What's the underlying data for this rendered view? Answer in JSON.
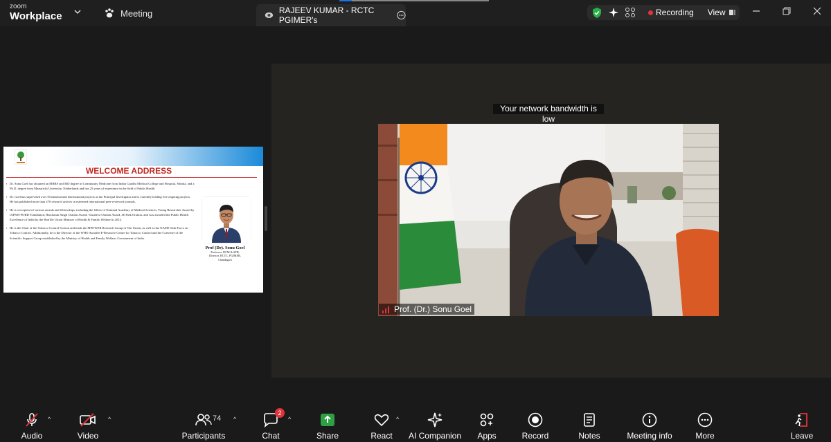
{
  "titlebar": {
    "brand_small": "zoom",
    "brand_big": "Workplace",
    "meeting_label": "Meeting",
    "share_tab_label": "RAJEEV KUMAR - RCTC PGIMER's",
    "recording_label": "Recording",
    "view_label": "View"
  },
  "slide": {
    "title": "WELCOME ADDRESS",
    "bullets": [
      "Dr. Sonu Goel has obtained an MBBS and MD degree in Community Medicine from Indira Gandhi Medical College and Hospital, Shimla, and a Ph.D. degree from Maastricht University, Netherlands and has 25 years of experience in the field of Public Health.",
      "Dr. Goel has supervised over 50 national and international projects as the Principal Investigator and is currently leading five ongoing projects. He has published more than 270 research articles in esteemed international peer-reviewed journals.",
      "He is a recipient of various awards and fellowships, including the fellow of National Academy of Medical Sciences, Young Researcher Award by IAPSM-FORD Foundation, Harcharan Singh Oration Award, Vasudeva Oration Award, JE Park Oration, and was awarded the Public Health Excellence of India by the Hon'ble Union Minister of Health & Family Welfare in 2014.",
      "He is the Chair of the Tobacco Control Section and leads the MPOWER Research Group of The Union, as well as the NAMS Task Force on Tobacco Control. Additionally, he is the Director of the WHO Awardee E-Resource Centre for Tobacco Control and the Convener of the Scientific Support Group established by the Ministry of Health and Family Welfare, Government of India."
    ],
    "speaker_name": "Prof (Dr). Sonu Goel",
    "speaker_role_1": "Professor, DCM & SPH,",
    "speaker_role_2": "Director, RCTC, PGIMER,",
    "speaker_role_3": "Chandigarh"
  },
  "video": {
    "network_warning": "Your network bandwidth is low",
    "participant_name": "Prof. (Dr.) Sonu Goel"
  },
  "toolbar": {
    "audio": "Audio",
    "video": "Video",
    "participants": "Participants",
    "participants_count": "74",
    "chat": "Chat",
    "chat_badge": "2",
    "share": "Share",
    "react": "React",
    "ai_companion": "AI Companion",
    "apps": "Apps",
    "record": "Record",
    "notes": "Notes",
    "meeting_info": "Meeting info",
    "more": "More",
    "leave": "Leave"
  },
  "colors": {
    "share_green": "#2ea043",
    "recording_red": "#e0343a",
    "mute_red": "#e0343a",
    "shield_green": "#27b148",
    "slide_title_red": "#c0261f"
  },
  "icons": [
    "zoom-logo",
    "chevron-down-icon",
    "paw-icon",
    "sharer-avatar-icon",
    "more-icon",
    "shield-check-icon",
    "sparkle-icon",
    "screens-icon",
    "view-icon",
    "minimize-icon",
    "restore-icon",
    "close-icon",
    "mic-muted-icon",
    "camera-off-icon",
    "participants-icon",
    "chat-icon",
    "share-arrow-icon",
    "heart-icon",
    "ai-sparkle-icon",
    "apps-icon",
    "record-icon",
    "notes-icon",
    "info-icon",
    "more-circle-icon",
    "leave-door-icon",
    "signal-bars-icon"
  ]
}
